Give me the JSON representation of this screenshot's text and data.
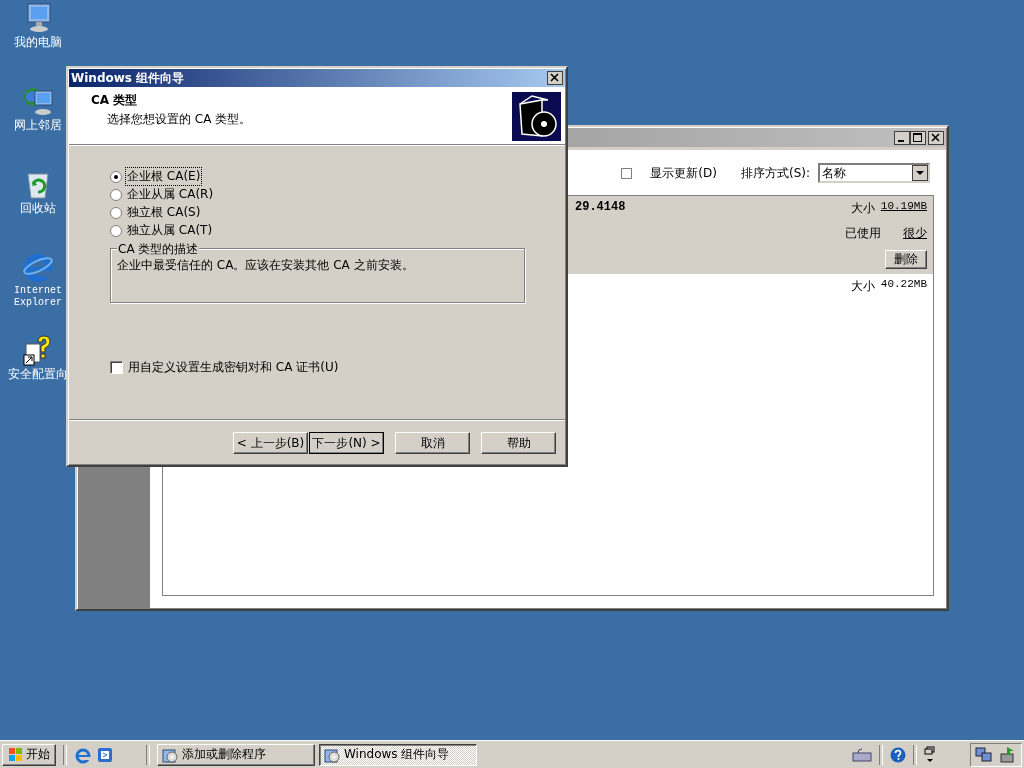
{
  "desktop_icons": [
    {
      "label": "我的电脑",
      "kind": "computer"
    },
    {
      "label": "网上邻居",
      "kind": "network"
    },
    {
      "label": "回收站",
      "kind": "recycle"
    },
    {
      "label": "Internet Explorer",
      "kind": "browser"
    },
    {
      "label": "安全配置向",
      "kind": "wizard"
    }
  ],
  "programs_window": {
    "show_updates": {
      "label": "显示更新(D)",
      "checked": false
    },
    "sort": {
      "label": "排序方式(S):",
      "value": "名称"
    },
    "items": [
      {
        "title": "29.4148",
        "size_label": "大小",
        "size": "10.19MB",
        "used_label": "已使用",
        "used": "很少",
        "remove_button": "删除",
        "selected": true
      },
      {
        "size_label": "大小",
        "size": "40.22MB",
        "selected": false
      }
    ]
  },
  "wizard": {
    "title": "Windows 组件向导",
    "header_title": "CA 类型",
    "header_subtitle": "选择您想设置的 CA 类型。",
    "options": [
      {
        "label": "企业根 CA(E)",
        "selected": true
      },
      {
        "label": "企业从属 CA(R)",
        "selected": false
      },
      {
        "label": "独立根 CA(S)",
        "selected": false
      },
      {
        "label": "独立从属 CA(T)",
        "selected": false
      }
    ],
    "description_title": "CA 类型的描述",
    "description": "企业中最受信任的 CA。应该在安装其他 CA 之前安装。",
    "custom_settings": {
      "label": "用自定义设置生成密钥对和 CA 证书(U)",
      "checked": false
    },
    "buttons": [
      {
        "label": "< 上一步(B)",
        "kind": "back"
      },
      {
        "label": "下一步(N) >",
        "kind": "next"
      },
      {
        "label": "取消",
        "kind": "cancel"
      },
      {
        "label": "帮助",
        "kind": "help"
      }
    ]
  },
  "taskbar": {
    "start": "开始",
    "tasks": [
      {
        "label": "添加或删除程序",
        "selected": false
      },
      {
        "label": "Windows 组件向导",
        "selected": true
      }
    ]
  }
}
